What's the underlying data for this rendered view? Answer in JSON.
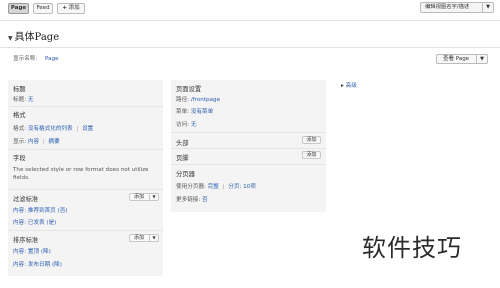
{
  "topbar": {
    "tabs": [
      {
        "label": "Page",
        "active": true
      },
      {
        "label": "Feed",
        "active": false
      }
    ],
    "add_label": "添加",
    "add_icon": "plus-icon",
    "editor_label": "编辑视图名字/描述"
  },
  "header": {
    "title": "具体Page",
    "display_name_label": "显示名称:",
    "display_name_value": "Page",
    "view_button": "查看 Page"
  },
  "left": {
    "title_section": {
      "heading": "标题",
      "label": "标题:",
      "value": "无"
    },
    "format_section": {
      "heading": "格式",
      "format_label": "格式:",
      "format_value": "没有格式化的列表",
      "format_settings": "设置",
      "show_label": "显示:",
      "show_value": "内容",
      "show_summary": "摘要"
    },
    "fields_section": {
      "heading": "字段",
      "note": "The selected style or row format does not utilize fields."
    },
    "filter_section": {
      "heading": "过滤标准",
      "add_label": "添加",
      "items": [
        "内容: 推荐到首页 (否)",
        "内容: 已发表 (是)"
      ]
    },
    "sort_section": {
      "heading": "排序标准",
      "add_label": "添加",
      "items": [
        "内容: 置顶 (降)",
        "内容: 发布日期 (降)"
      ]
    }
  },
  "middle": {
    "page_settings": {
      "heading": "页面设置",
      "path_label": "路径:",
      "path_value": "/frontpage",
      "menu_label": "菜单:",
      "menu_value": "没有菜单",
      "access_label": "访问:",
      "access_value": "无"
    },
    "header_section": {
      "heading": "头部",
      "add_label": "添加"
    },
    "footer_section": {
      "heading": "页脚",
      "add_label": "添加"
    },
    "pager_section": {
      "heading": "分页器",
      "use_label": "使用分页器:",
      "use_value": "完整",
      "per_page_value": "分页: 10项",
      "more_label": "更多链接:",
      "more_value": "否"
    }
  },
  "right": {
    "advanced_label": "高级"
  },
  "watermark": "软件技巧",
  "colors": {
    "link": "#2a5db0",
    "panel": "#f4f4f4"
  }
}
